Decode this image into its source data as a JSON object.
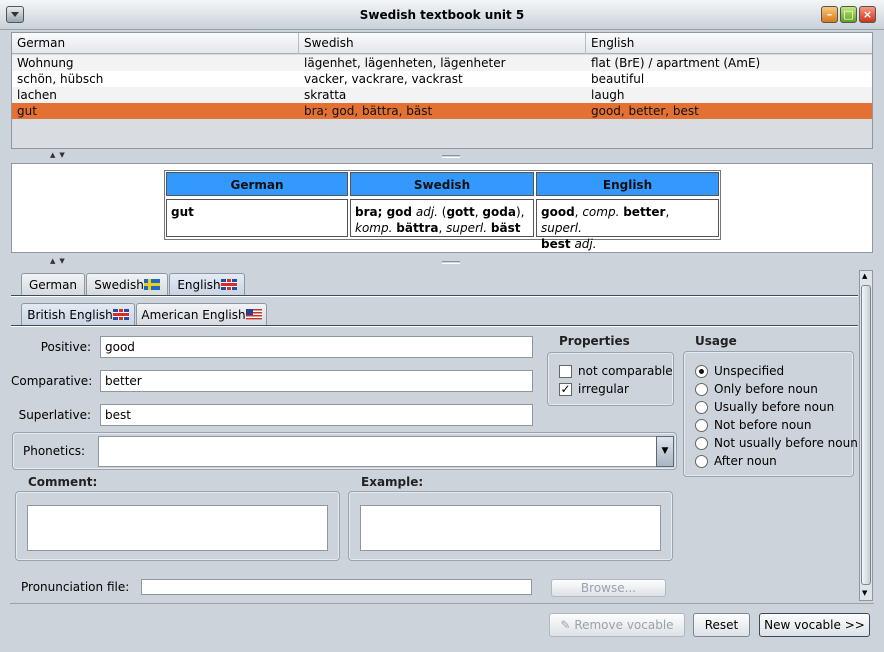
{
  "window": {
    "title": "Swedish textbook unit 5"
  },
  "vocab_table": {
    "columns": [
      "German",
      "Swedish",
      "English"
    ],
    "rows": [
      [
        "Wohnung",
        "lägenhet, lägenheten, lägenheter",
        "flat (BrE) / apartment (AmE)"
      ],
      [
        "schön, hübsch",
        "vacker, vackrare, vackrast",
        "beautiful"
      ],
      [
        "lachen",
        "skratta",
        "laugh"
      ],
      [
        "gut",
        "bra; god, bättra, bäst",
        "good, better, best"
      ]
    ],
    "selected_row": 3
  },
  "preview": {
    "headers": [
      "German",
      "Swedish",
      "English"
    ],
    "german": {
      "word": "gut"
    },
    "swedish": {
      "w1": "bra; god",
      "pos": "adj.",
      "o": " (",
      "w2": "gott",
      "sep": ", ",
      "w3": "goda",
      "c": "),",
      "komp_label": "komp.",
      "komp": "bättra",
      "comma": ",",
      "superl_label": "superl.",
      "superl": "bäst"
    },
    "english": {
      "w1": "good",
      "sep1": ",",
      "comp_label": "comp.",
      "comp": "better",
      "sep2": ",",
      "superl_label": "superl.",
      "superl": "best",
      "pos": "adj."
    }
  },
  "language_tabs": [
    "German",
    "Swedish",
    "English"
  ],
  "active_language_tab": "English",
  "variant_tabs": [
    "British English",
    "American English"
  ],
  "active_variant_tab": "British English",
  "form": {
    "positive_label": "Positive:",
    "positive": "good",
    "comparative_label": "Comparative:",
    "comparative": "better",
    "superlative_label": "Superlative:",
    "superlative": "best",
    "phonetics_label": "Phonetics:",
    "phonetics": ""
  },
  "properties": {
    "title": "Properties",
    "not_comparable": {
      "label": "not comparable",
      "checked": false
    },
    "irregular": {
      "label": "irregular",
      "checked": true
    }
  },
  "usage": {
    "title": "Usage",
    "options": [
      "Unspecified",
      "Only before noun",
      "Usually before noun",
      "Not before noun",
      "Not usually before noun",
      "After noun"
    ],
    "selected": "Unspecified"
  },
  "comment": {
    "label": "Comment:",
    "value": ""
  },
  "example": {
    "label": "Example:",
    "value": ""
  },
  "pronunciation": {
    "label": "Pronunciation file:",
    "value": "",
    "browse_label": "Browse..."
  },
  "buttons": {
    "remove": "Remove vocable",
    "reset": "Reset",
    "new_vocable": "New vocable >>"
  }
}
